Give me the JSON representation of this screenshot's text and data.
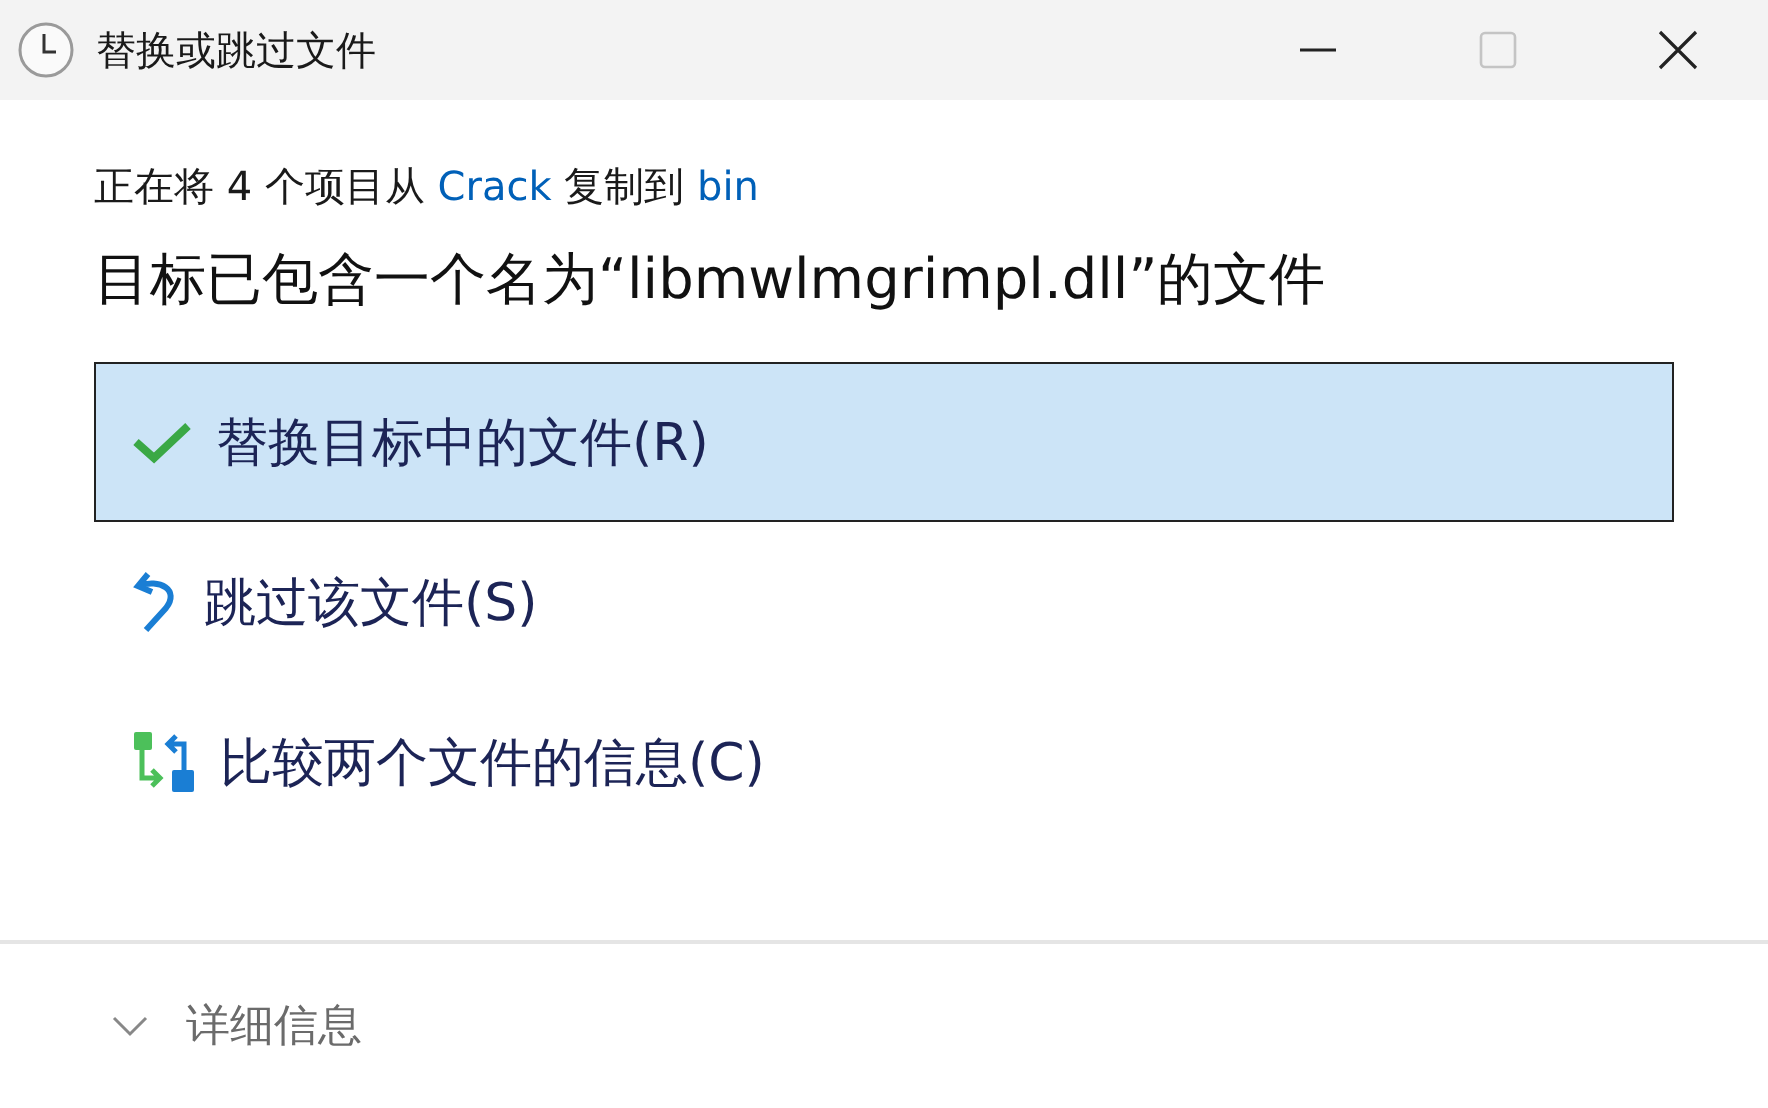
{
  "window": {
    "title": "替换或跳过文件"
  },
  "status": {
    "prefix": "正在将 4 个项目从 ",
    "source": "Crack",
    "middle": " 复制到 ",
    "destination": "bin"
  },
  "heading": "目标已包含一个名为“libmwlmgrimpl.dll”的文件",
  "options": [
    {
      "kind": "replace",
      "label": "替换目标中的文件(R)",
      "selected": true
    },
    {
      "kind": "skip",
      "label": "跳过该文件(S)",
      "selected": false
    },
    {
      "kind": "compare",
      "label": "比较两个文件的信息(C)",
      "selected": false
    }
  ],
  "details": {
    "label": "详细信息",
    "expanded": false
  }
}
